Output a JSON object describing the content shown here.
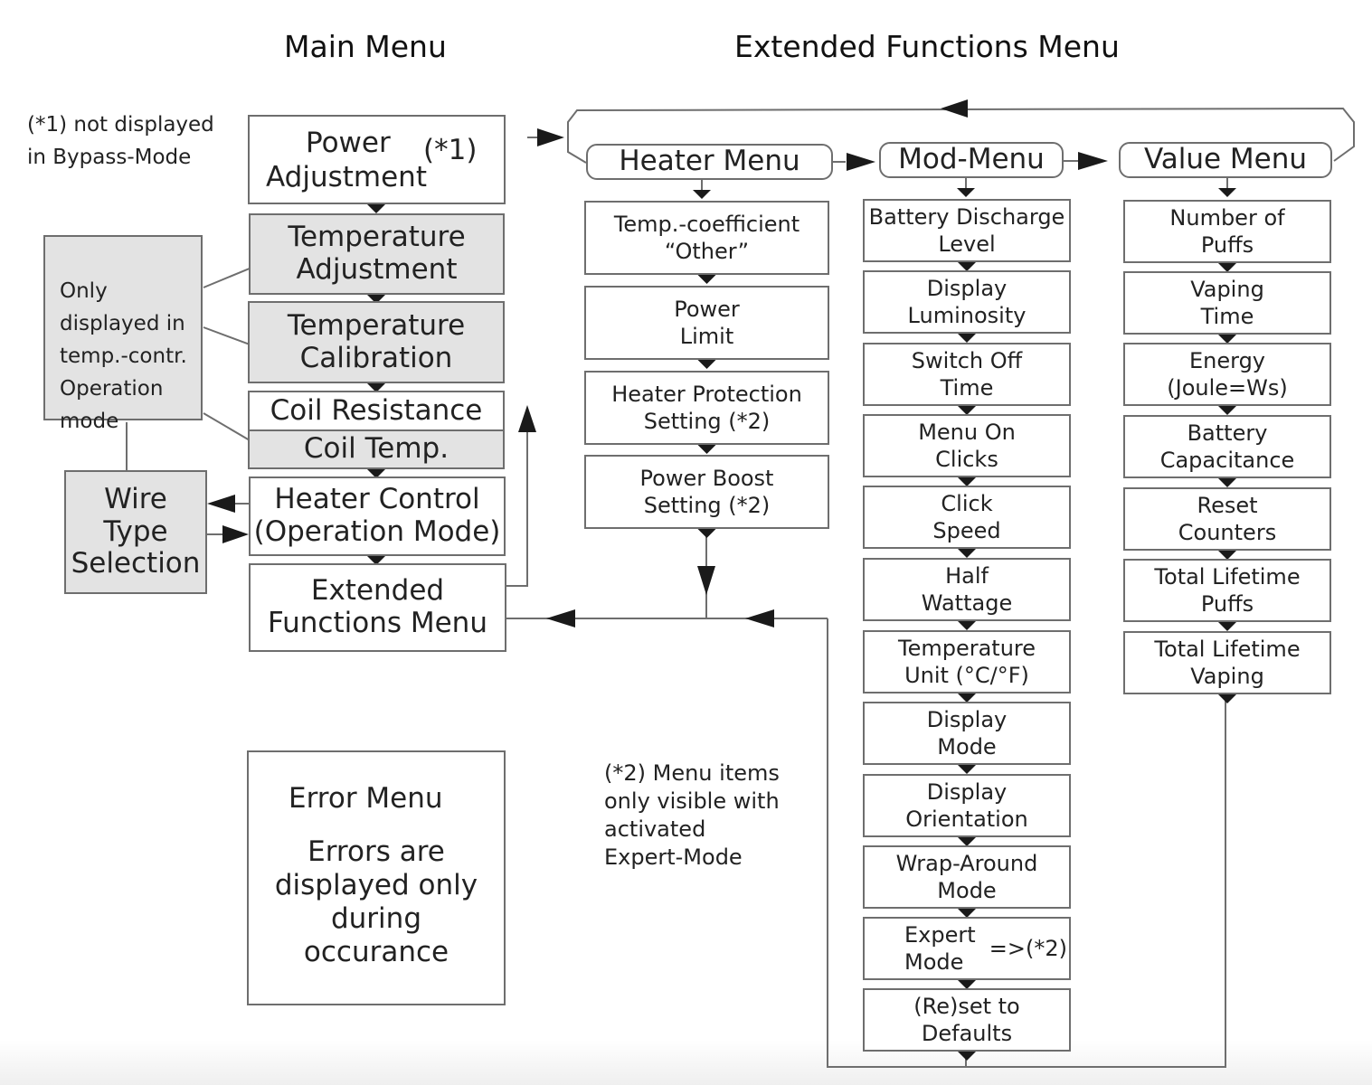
{
  "titles": {
    "main_menu": "Main Menu",
    "extended_menu": "Extended Functions Menu"
  },
  "notes": {
    "bypass_note": "(*1) not displayed\nin Bypass-Mode",
    "temp_control_note": "Only\ndisplayed in\ntemp.-contr.\nOperation\nmode",
    "expert_note": "(*2) Menu items\nonly visible with\nactivated\nExpert-Mode"
  },
  "main_menu": {
    "power_adjustment": [
      "Power",
      "Adjustment"
    ],
    "power_adjustment_mark": "(*1)",
    "temperature_adjustment": [
      "Temperature",
      "Adjustment"
    ],
    "temperature_calibration": [
      "Temperature",
      "Calibration"
    ],
    "coil_resistance": "Coil Resistance",
    "coil_temp": "Coil Temp.",
    "heater_control": [
      "Heater Control",
      "(Operation Mode)"
    ],
    "extended_functions": [
      "Extended",
      "Functions Menu"
    ],
    "wire_type_selection": [
      "Wire",
      "Type",
      "Selection"
    ]
  },
  "error_menu": {
    "title": "Error Menu",
    "text": [
      "Errors are",
      "displayed only",
      "during",
      "occurance"
    ]
  },
  "extended": {
    "heater_menu": {
      "label": "Heater Menu",
      "items": [
        [
          "Temp.-coefficient",
          "“Other”"
        ],
        [
          "Power",
          "Limit"
        ],
        [
          "Heater Protection",
          "Setting (*2)"
        ],
        [
          "Power Boost",
          "Setting (*2)"
        ]
      ]
    },
    "mod_menu": {
      "label": "Mod-Menu",
      "items": [
        [
          "Battery Discharge",
          "Level"
        ],
        [
          "Display",
          "Luminosity"
        ],
        [
          "Switch Off",
          "Time"
        ],
        [
          "Menu On",
          "Clicks"
        ],
        [
          "Click",
          "Speed"
        ],
        [
          "Half",
          "Wattage"
        ],
        [
          "Temperature",
          "Unit (°C/°F)"
        ],
        [
          "Display",
          "Mode"
        ],
        [
          "Display",
          "Orientation"
        ],
        [
          "Wrap-Around",
          "Mode"
        ],
        [
          "Expert",
          "Mode"
        ],
        [
          "(Re)set to",
          "Defaults"
        ]
      ],
      "expert_mark": "=>(*2)"
    },
    "value_menu": {
      "label": "Value Menu",
      "items": [
        [
          "Number of",
          "Puffs"
        ],
        [
          "Vaping",
          "Time"
        ],
        [
          "Energy",
          "(Joule=Ws)"
        ],
        [
          "Battery",
          "Capacitance"
        ],
        [
          "Reset",
          "Counters"
        ],
        [
          "Total Lifetime",
          "Puffs"
        ],
        [
          "Total Lifetime",
          "Vaping"
        ]
      ]
    }
  }
}
